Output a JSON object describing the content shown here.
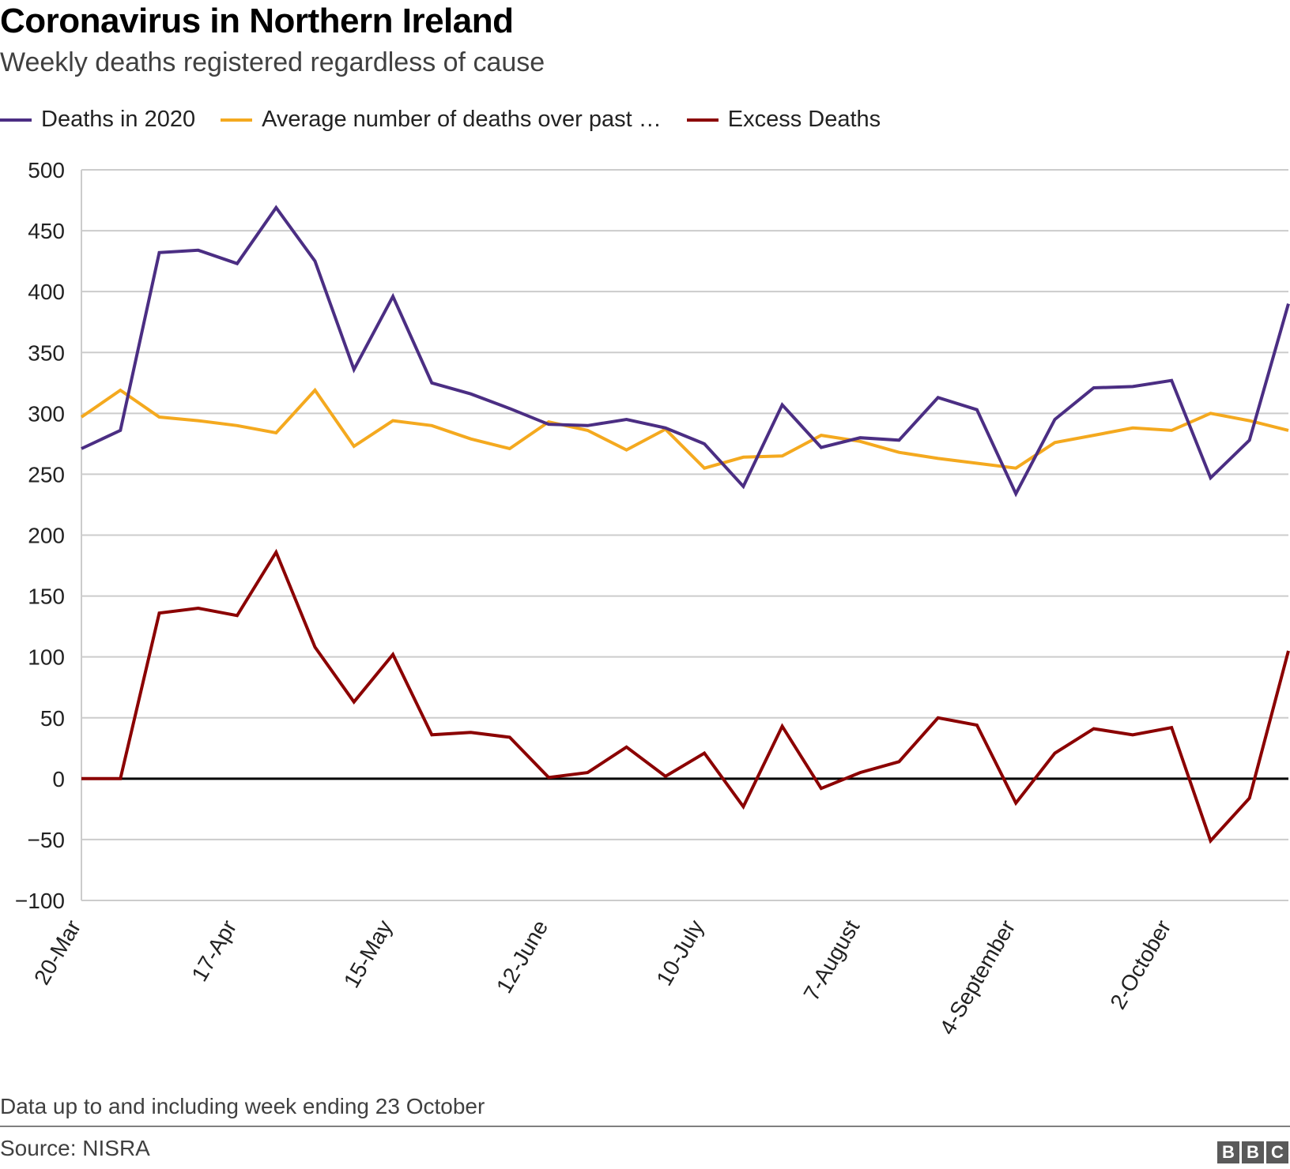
{
  "header": {
    "title": "Coronavirus in Northern Ireland",
    "subtitle": "Weekly deaths registered regardless of cause"
  },
  "legend": [
    {
      "label": "Deaths in 2020",
      "color": "#4b2e83"
    },
    {
      "label": "Average number of deaths over past …",
      "color": "#f4a91f"
    },
    {
      "label": "Excess Deaths",
      "color": "#8b0000"
    }
  ],
  "footer": {
    "note": "Data up to and including week ending 23 October",
    "source": "Source: NISRA",
    "logo_letters": [
      "B",
      "B",
      "C"
    ]
  },
  "chart_data": {
    "type": "line",
    "title": "Coronavirus in Northern Ireland",
    "subtitle": "Weekly deaths registered regardless of cause",
    "xlabel": "",
    "ylabel": "",
    "ylim": [
      -100,
      500
    ],
    "yticks": [
      500,
      450,
      400,
      350,
      300,
      250,
      200,
      150,
      100,
      50,
      0,
      -50,
      -100
    ],
    "ytick_labels": [
      "500",
      "450",
      "400",
      "350",
      "300",
      "250",
      "200",
      "150",
      "100",
      "50",
      "0",
      "−50",
      "−100"
    ],
    "grid": true,
    "legend_position": "top-left",
    "x_tick_labels": [
      {
        "index": 0,
        "label": "20-Mar"
      },
      {
        "index": 4,
        "label": "17-Apr"
      },
      {
        "index": 8,
        "label": "15-May"
      },
      {
        "index": 12,
        "label": "12-June"
      },
      {
        "index": 16,
        "label": "10-July"
      },
      {
        "index": 20,
        "label": "7-August"
      },
      {
        "index": 24,
        "label": "4-September"
      },
      {
        "index": 28,
        "label": "2-October"
      }
    ],
    "n_points": 32,
    "series": [
      {
        "name": "Deaths in 2020",
        "color": "#4b2e83",
        "values": [
          271,
          286,
          432,
          434,
          423,
          469,
          425,
          336,
          396,
          325,
          316,
          304,
          291,
          290,
          295,
          288,
          275,
          240,
          307,
          272,
          280,
          278,
          313,
          303,
          234,
          295,
          321,
          322,
          327,
          247,
          278,
          390
        ]
      },
      {
        "name": "Average number of deaths over past …",
        "color": "#f4a91f",
        "values": [
          297,
          319,
          297,
          294,
          290,
          284,
          319,
          273,
          294,
          290,
          279,
          271,
          293,
          286,
          270,
          287,
          255,
          264,
          265,
          282,
          277,
          268,
          263,
          259,
          255,
          276,
          282,
          288,
          286,
          300,
          294,
          286
        ]
      },
      {
        "name": "Excess Deaths",
        "color": "#8b0000",
        "values": [
          0,
          0,
          136,
          140,
          134,
          186,
          108,
          63,
          102,
          36,
          38,
          34,
          1,
          5,
          26,
          2,
          21,
          -23,
          43,
          -8,
          5,
          14,
          50,
          44,
          -20,
          21,
          41,
          36,
          42,
          -51,
          -16,
          105
        ]
      }
    ]
  }
}
